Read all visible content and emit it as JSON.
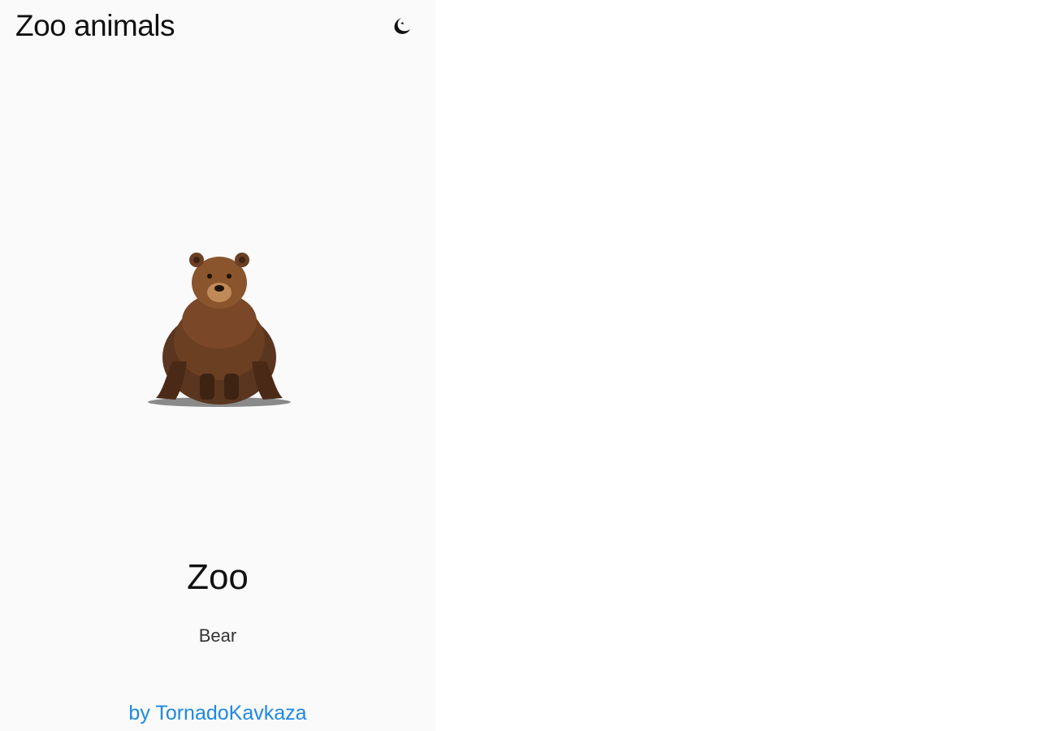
{
  "app_bar": {
    "title": "Zoo animals",
    "theme_toggle_icon": "moon-icon"
  },
  "content": {
    "image_icon": "bear-image",
    "section_title": "Zoo",
    "animal_name": "Bear"
  },
  "footer": {
    "author_link": "by TornadoKavkaza",
    "link_color": "#1e88e5"
  },
  "colors": {
    "app_background": "#fafafa",
    "text": "#111111"
  }
}
